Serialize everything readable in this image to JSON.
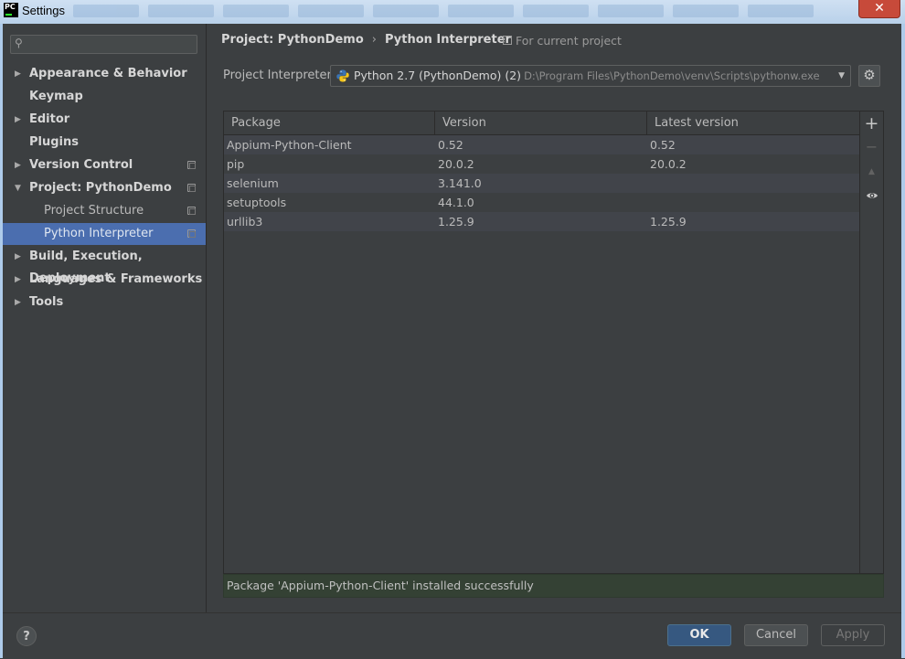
{
  "window": {
    "title": "Settings",
    "app_logo": "PC"
  },
  "sidebar": {
    "search_placeholder": "",
    "items": [
      {
        "label": "Appearance & Behavior",
        "expandable": true
      },
      {
        "label": "Keymap",
        "expandable": false
      },
      {
        "label": "Editor",
        "expandable": true
      },
      {
        "label": "Plugins",
        "expandable": false
      },
      {
        "label": "Version Control",
        "expandable": true
      },
      {
        "label": "Project: PythonDemo",
        "expandable": true,
        "expanded": true
      },
      {
        "label": "Project Structure",
        "sub": true
      },
      {
        "label": "Python Interpreter",
        "sub": true,
        "selected": true
      },
      {
        "label": "Build, Execution, Deployment",
        "expandable": true
      },
      {
        "label": "Languages & Frameworks",
        "expandable": true
      },
      {
        "label": "Tools",
        "expandable": true
      }
    ]
  },
  "main": {
    "breadcrumb": [
      "Project: PythonDemo",
      "Python Interpreter"
    ],
    "breadcrumb_separator": "›",
    "scope": "For current project",
    "interpreter_label": "Project Interpreter:",
    "interpreter_name": "Python 2.7 (PythonDemo) (2)",
    "interpreter_path": "D:\\Program Files\\PythonDemo\\venv\\Scripts\\pythonw.exe",
    "table": {
      "headers": [
        "Package",
        "Version",
        "Latest version"
      ],
      "rows": [
        [
          "Appium-Python-Client",
          "0.52",
          "0.52"
        ],
        [
          "pip",
          "20.0.2",
          "20.0.2"
        ],
        [
          "selenium",
          "3.141.0",
          ""
        ],
        [
          "setuptools",
          "44.1.0",
          ""
        ],
        [
          "urllib3",
          "1.25.9",
          "1.25.9"
        ]
      ]
    },
    "status_message": "Package 'Appium-Python-Client' installed successfully"
  },
  "footer": {
    "help": "?",
    "ok": "OK",
    "cancel": "Cancel",
    "apply": "Apply"
  },
  "colors": {
    "background": "#3c3f41",
    "selection": "#4b6eaf",
    "ok_button": "#365880",
    "status_bg": "#344134"
  }
}
